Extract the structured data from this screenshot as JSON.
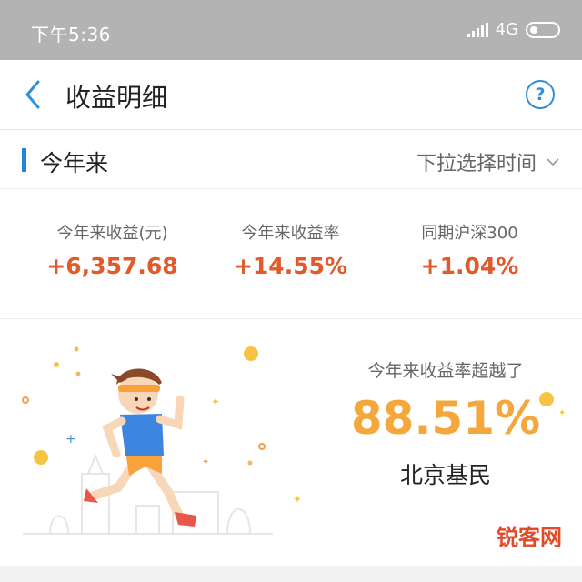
{
  "status_bar": {
    "time": "下午5:36",
    "network": "4G"
  },
  "nav": {
    "title": "收益明细"
  },
  "section": {
    "title": "今年来",
    "dropdown_label": "下拉选择时间"
  },
  "stats": [
    {
      "label": "今年来收益(元)",
      "value": "+6,357.68"
    },
    {
      "label": "今年来收益率",
      "value": "+14.55%"
    },
    {
      "label": "同期沪深300",
      "value": "+1.04%"
    }
  ],
  "hero": {
    "label": "今年来收益率超越了",
    "percent": "88.51%",
    "caption": "北京基民"
  },
  "watermark": {
    "part1": "锐",
    "part2": "客",
    "part3": "网"
  },
  "colors": {
    "accent": "#1e88d8",
    "value_red": "#e05a2a",
    "hero_orange": "#f4a83c",
    "coin_yellow": "#f6c343"
  }
}
